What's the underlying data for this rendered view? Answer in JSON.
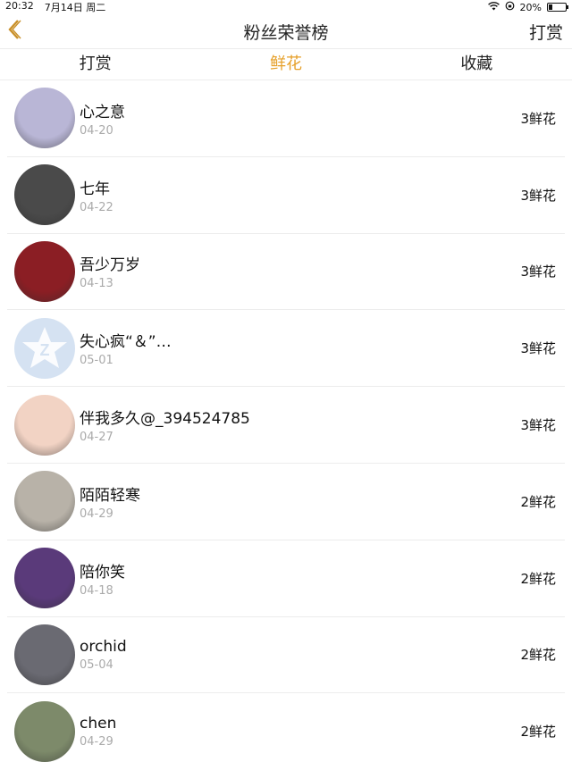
{
  "status_bar": {
    "time": "20:32",
    "date": "7月14日 周二",
    "battery": "20%",
    "battery_level": 0.2
  },
  "nav": {
    "title": "粉丝荣誉榜",
    "action": "打赏",
    "back_icon": "chevron-left-icon",
    "accent_color": "#e6a02a"
  },
  "tabs": [
    {
      "label": "打赏",
      "active": false
    },
    {
      "label": "鲜花",
      "active": true
    },
    {
      "label": "收藏",
      "active": false
    }
  ],
  "fans": [
    {
      "name": "心之意",
      "date": "04-20",
      "gift": "3鲜花",
      "avatar_color": "#b9b6d6"
    },
    {
      "name": "七年",
      "date": "04-22",
      "gift": "3鲜花",
      "avatar_color": "#4a4a4a"
    },
    {
      "name": "吾少万岁",
      "date": "04-13",
      "gift": "3鲜花",
      "avatar_color": "#8b1e24"
    },
    {
      "name": "失心疯“＆”…",
      "date": "05-01",
      "gift": "3鲜花",
      "avatar_color": "#d5e2f2"
    },
    {
      "name": "伴我多久@_394524785",
      "date": "04-27",
      "gift": "3鲜花",
      "avatar_color": "#f2d3c4"
    },
    {
      "name": "陌陌轻寒",
      "date": "04-29",
      "gift": "2鲜花",
      "avatar_color": "#b8b2a8"
    },
    {
      "name": "陪你笑",
      "date": "04-18",
      "gift": "2鲜花",
      "avatar_color": "#5a3a7a"
    },
    {
      "name": "orchid",
      "date": "05-04",
      "gift": "2鲜花",
      "avatar_color": "#6a6a72"
    },
    {
      "name": "chen",
      "date": "04-29",
      "gift": "2鲜花",
      "avatar_color": "#7d8a6a"
    }
  ]
}
